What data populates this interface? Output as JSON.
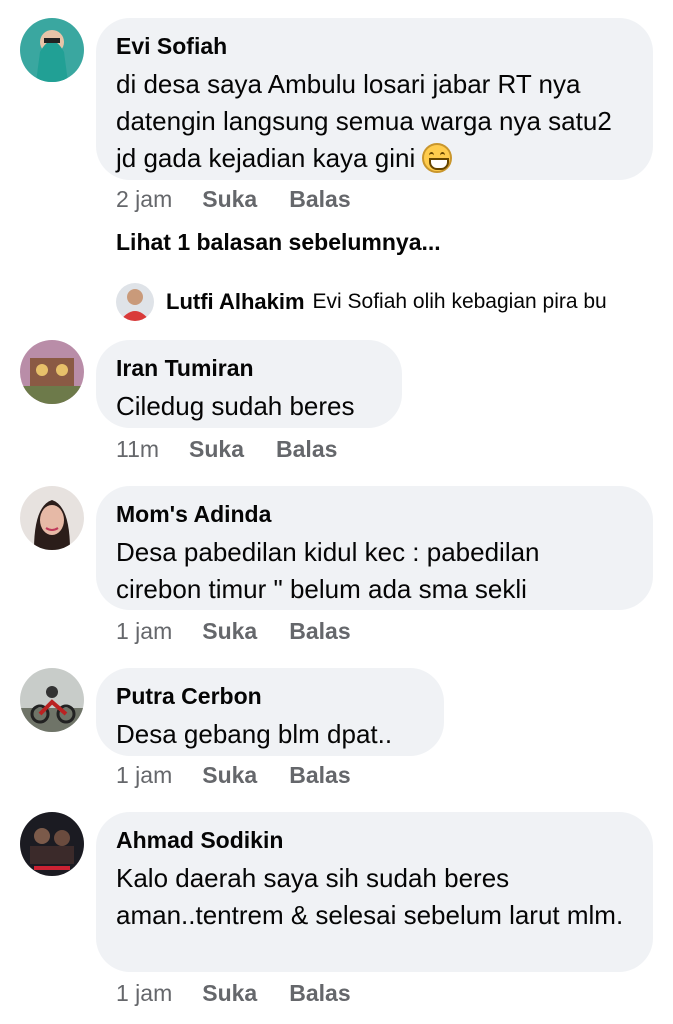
{
  "comments": [
    {
      "name": "Evi Sofiah",
      "text": "di desa saya Ambulu losari jabar RT nya datengin langsung semua warga nya satu2 jd gada kejadian kaya gini",
      "emoji": "grinning-face-icon",
      "time": "2 jam",
      "like": "Suka",
      "reply": "Balas"
    },
    {
      "name": "Iran Tumiran",
      "text": "Ciledug sudah beres",
      "time": "11m",
      "like": "Suka",
      "reply": "Balas"
    },
    {
      "name": "Mom's Adinda",
      "text": "Desa pabedilan kidul kec : pabedilan cirebon timur \" belum ada sma sekli",
      "time": "1 jam",
      "like": "Suka",
      "reply": "Balas"
    },
    {
      "name": "Putra Cerbon",
      "text": "Desa gebang blm dpat..",
      "time": "1 jam",
      "like": "Suka",
      "reply": "Balas"
    },
    {
      "name": "Ahmad Sodikin",
      "text": "Kalo daerah saya sih sudah beres aman..tentrem & selesai sebelum larut mlm.",
      "time": "1 jam",
      "like": "Suka",
      "reply": "Balas"
    }
  ],
  "previous_replies": "Lihat 1 balasan sebelumnya...",
  "reply_preview": {
    "name": "Lutfi Alhakim",
    "text": "Evi Sofiah olih kebagian pira bu"
  },
  "colors": {
    "bubble": "#f0f2f5",
    "meta": "#65676b",
    "text": "#050505"
  }
}
